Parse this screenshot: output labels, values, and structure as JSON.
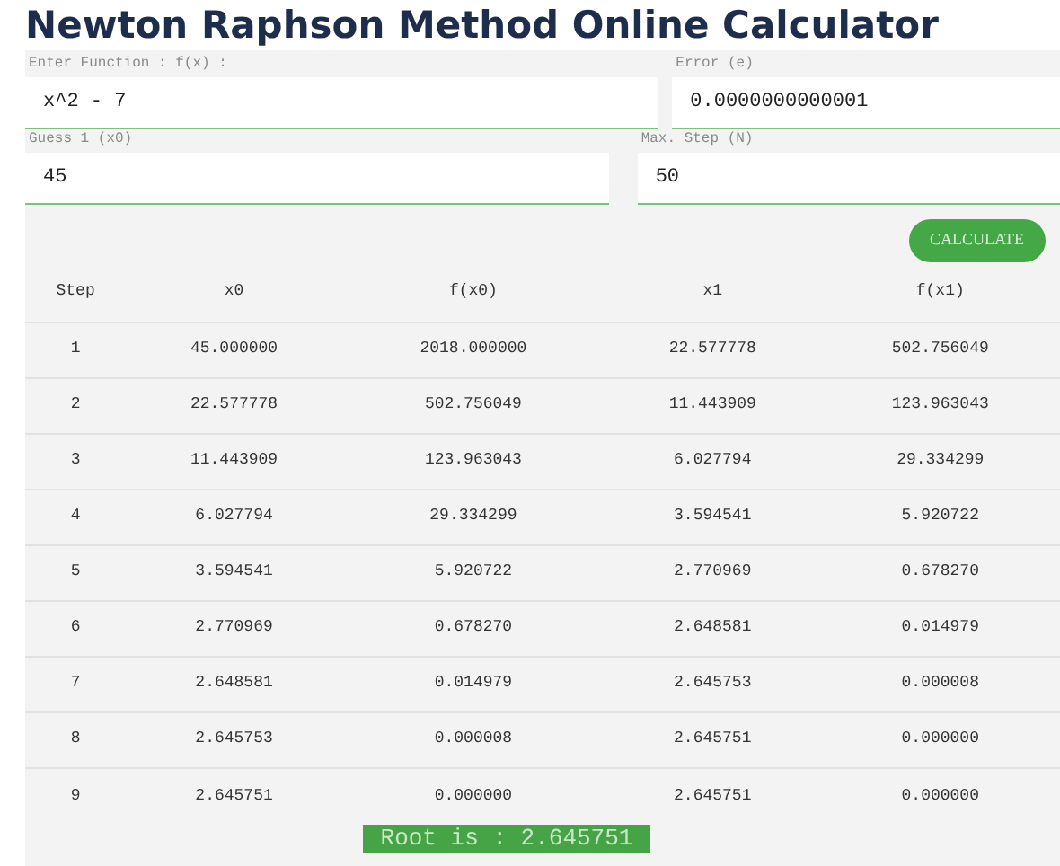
{
  "title": "Newton Raphson Method Online Calculator",
  "fields": [
    {
      "label": "Enter Function : f(x) :",
      "value": "x^2 - 7"
    },
    {
      "label": "Error (e)",
      "value": "0.0000000000001"
    },
    {
      "label": "Guess 1 (x0)",
      "value": "45"
    },
    {
      "label": "Max. Step (N)",
      "value": "50"
    }
  ],
  "button": "CALCULATE",
  "table": {
    "columns": [
      "Step",
      "x0",
      "f(x0)",
      "x1",
      "f(x1)"
    ],
    "rows": [
      [
        "1",
        "45.000000",
        "2018.000000",
        "22.577778",
        "502.756049"
      ],
      [
        "2",
        "22.577778",
        "502.756049",
        "11.443909",
        "123.963043"
      ],
      [
        "3",
        "11.443909",
        "123.963043",
        "6.027794",
        "29.334299"
      ],
      [
        "4",
        "6.027794",
        "29.334299",
        "3.594541",
        "5.920722"
      ],
      [
        "5",
        "3.594541",
        "5.920722",
        "2.770969",
        "0.678270"
      ],
      [
        "6",
        "2.770969",
        "0.678270",
        "2.648581",
        "0.014979"
      ],
      [
        "7",
        "2.648581",
        "0.014979",
        "2.645753",
        "0.000008"
      ],
      [
        "8",
        "2.645753",
        "0.000008",
        "2.645751",
        "0.000000"
      ],
      [
        "9",
        "2.645751",
        "0.000000",
        "2.645751",
        "0.000000"
      ]
    ]
  },
  "result": "Root is : 2.645751"
}
